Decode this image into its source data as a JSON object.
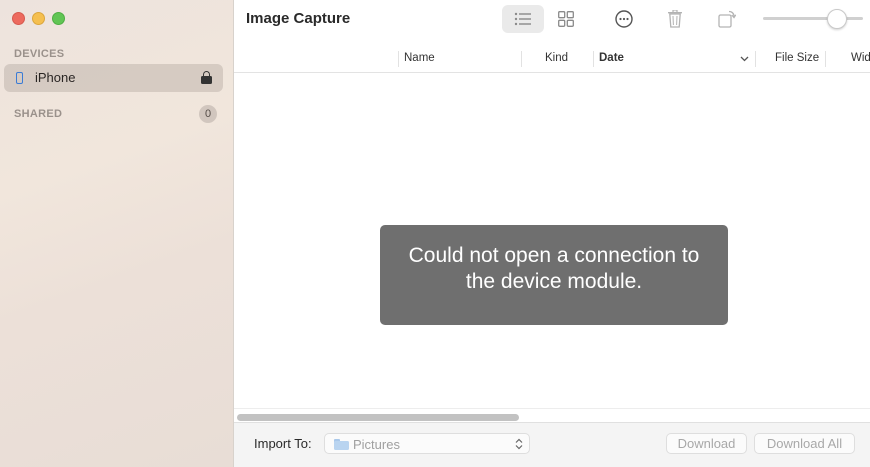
{
  "window": {
    "title": "Image Capture"
  },
  "sidebar": {
    "devices_title": "DEVICES",
    "device": {
      "name": "iPhone",
      "icon": "iphone-icon",
      "locked": true
    },
    "shared_title": "SHARED",
    "shared_count": "0"
  },
  "toolbar": {
    "icons": [
      "list-view-icon",
      "grid-view-icon",
      "more-options-icon",
      "trash-icon",
      "rotate-icon"
    ],
    "zoom_slider_fraction": 0.74
  },
  "table": {
    "columns": [
      "Name",
      "Kind",
      "Date",
      "File Size",
      "Wid"
    ],
    "sorted_by": "Date"
  },
  "error": {
    "message": "Could not open a connection to the device module."
  },
  "bottom": {
    "import_label": "Import To:",
    "import_destination": "Pictures",
    "download_label": "Download",
    "download_all_label": "Download All"
  },
  "colors": {
    "accent_blue": "#3a7bd5",
    "error_overlay": "#6f6f6f",
    "close": "#ed6a5e",
    "minimize": "#f5bf4f",
    "maximize": "#61c554"
  }
}
